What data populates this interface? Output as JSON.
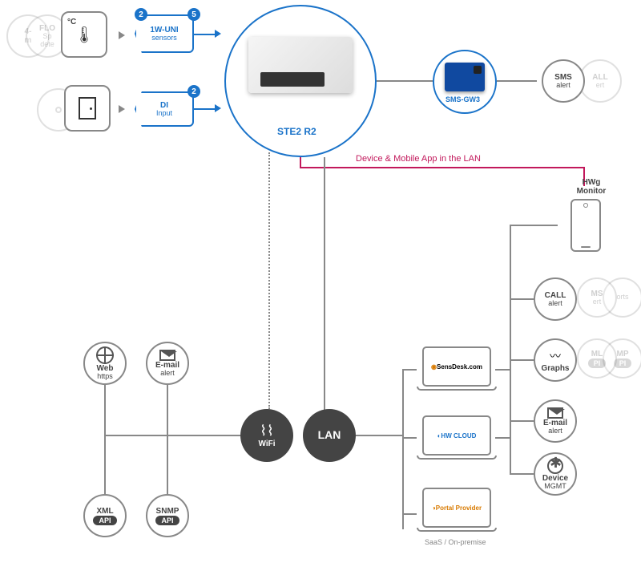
{
  "inputs": {
    "analog": {
      "label_top": "4-",
      "label_bot": "m"
    },
    "flood": {
      "label_top": "FLO",
      "label_mid": "Sp",
      "label_bot": "dete"
    },
    "temp": {
      "unit": "°C"
    },
    "sensor_bus": {
      "count_a": "2",
      "label": "1W-UNI",
      "sub": "sensors",
      "count_b": "5"
    },
    "door": {},
    "di": {
      "count": "2",
      "label": "DI",
      "sub": "Input"
    }
  },
  "hub": {
    "label": "STE2 R2"
  },
  "sms": {
    "label": "SMS-GW3"
  },
  "alerts_top": {
    "sms": {
      "t": "SMS",
      "s": "alert"
    },
    "call": {
      "t": "ALL",
      "s": "ert"
    }
  },
  "red_note": "Device & Mobile App in the LAN",
  "mobile": {
    "label": "HWg Monitor"
  },
  "right_icons": {
    "call": {
      "t": "CALL",
      "s": "alert"
    },
    "ms": {
      "t": "MS",
      "s": "ert"
    },
    "rep": {
      "t": "",
      "s": "orts"
    },
    "graphs": {
      "t": "Graphs"
    },
    "ml": {
      "t": "ML",
      "s": "PI"
    },
    "mp": {
      "t": "MP",
      "s": "PI"
    },
    "email": {
      "t": "E-mail",
      "s": "alert"
    },
    "dev": {
      "t": "Device",
      "s": "MGMT"
    }
  },
  "laptops": {
    "sensdesk": "SensDesk.com",
    "hw": "HW CLOUD",
    "portal": "Portal Provider",
    "caption": "SaaS / On-premise"
  },
  "net": {
    "wifi": "WiFi",
    "lan": "LAN"
  },
  "left_icons": {
    "web": {
      "t": "Web",
      "s": "https"
    },
    "email": {
      "t": "E-mail",
      "s": "alert"
    },
    "xml": {
      "t": "XML",
      "s": "API"
    },
    "snmp": {
      "t": "SNMP",
      "s": "API"
    }
  }
}
